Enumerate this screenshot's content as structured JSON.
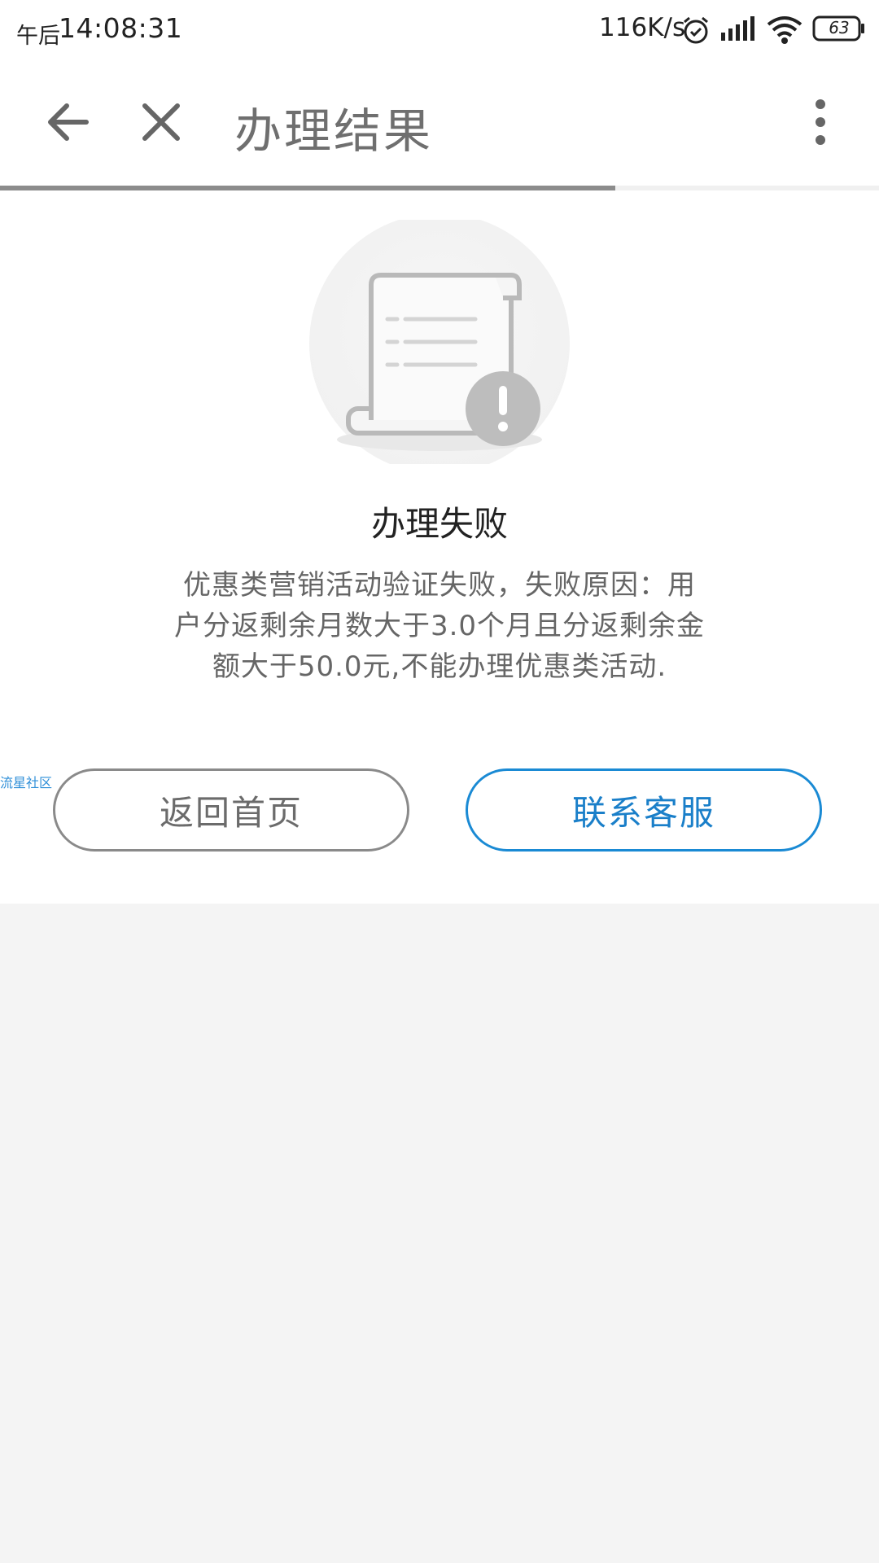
{
  "status_bar": {
    "time_prefix": "午后",
    "time": "14:08:31",
    "net_speed": "116K/s",
    "battery_level": "63",
    "icons": [
      "alarm-icon",
      "signal-icon",
      "wifi-icon",
      "battery-icon"
    ]
  },
  "header": {
    "title": "办理结果",
    "icons": [
      "arrow-left-icon",
      "close-icon",
      "more-vertical-icon"
    ],
    "page_load_progress": 0.7
  },
  "result": {
    "illustration": "document-warning-icon",
    "title": "办理失败",
    "message": "优惠类营销活动验证失败，失败原因：用户分返剩余月数大于3.0个月且分返剩余金额大于50.0元,不能办理优惠类活动."
  },
  "watermark": "流星社区",
  "buttons": {
    "home_label": "返回首页",
    "service_label": "联系客服"
  },
  "colors": {
    "accent": "#1a7fc9",
    "text_primary": "#222222",
    "text_secondary": "#666666",
    "background": "#f4f4f4"
  }
}
